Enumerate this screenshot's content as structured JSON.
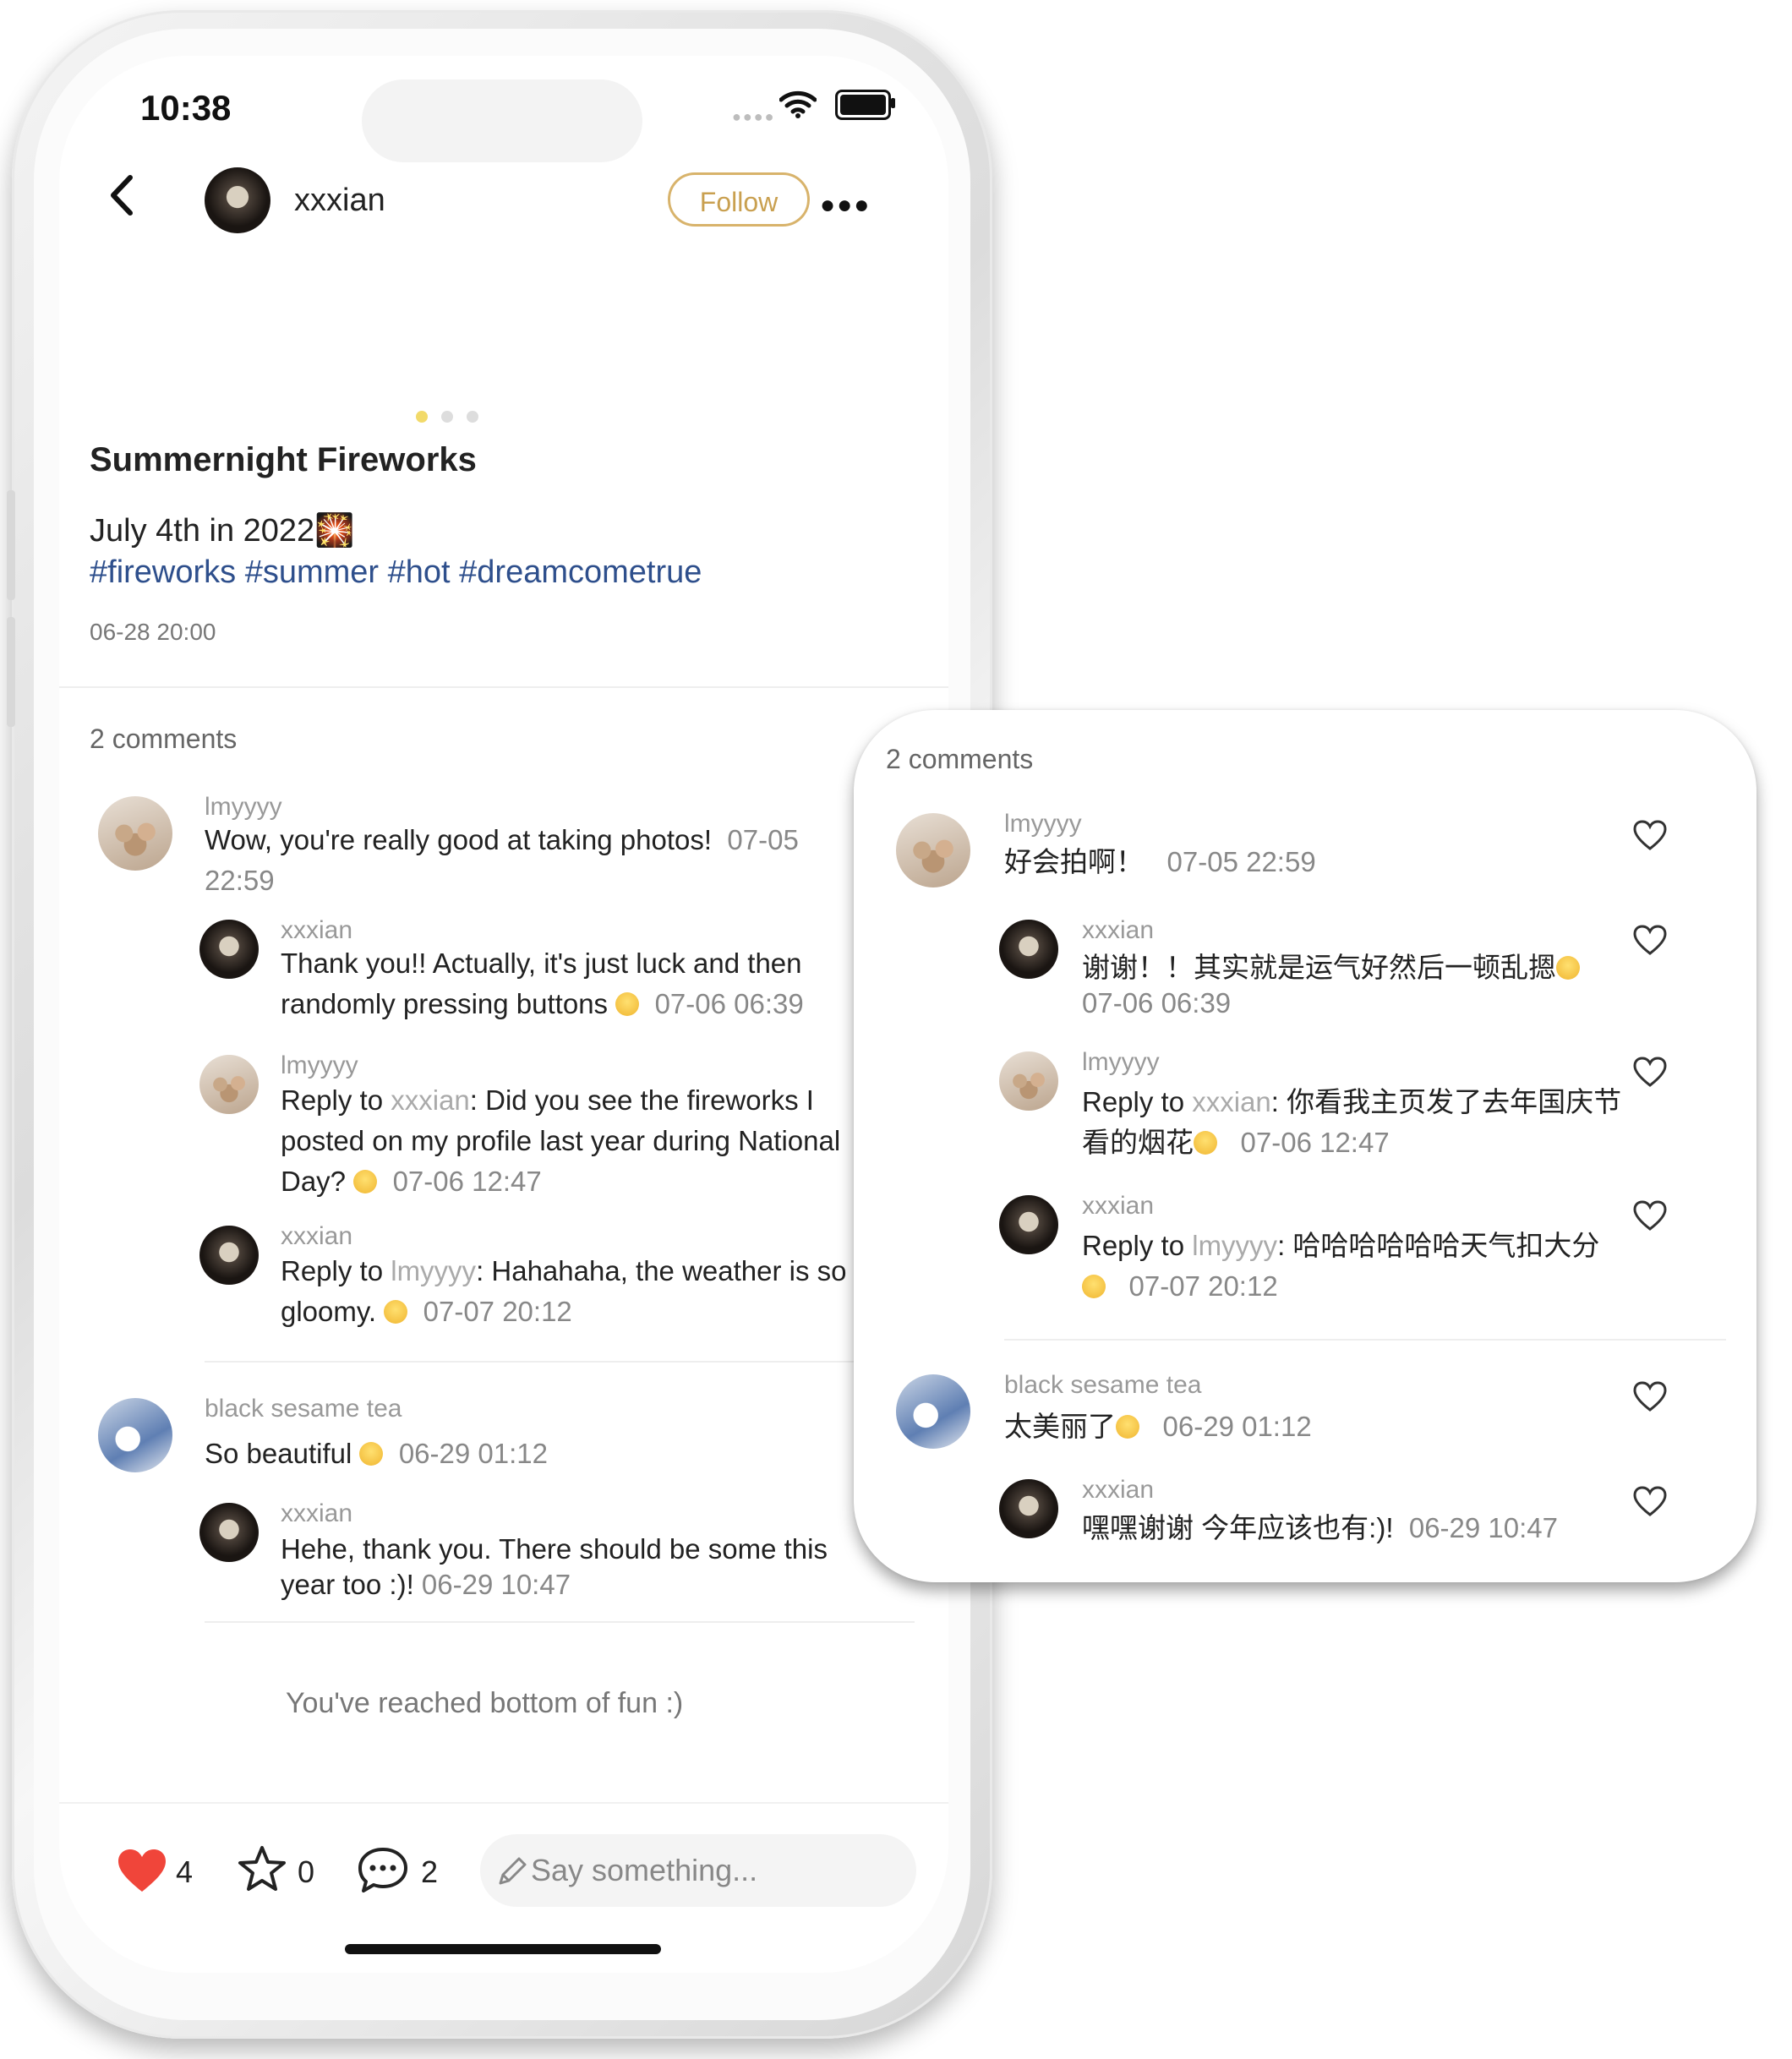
{
  "status": {
    "time": "10:38"
  },
  "header": {
    "username": "xxxian",
    "follow_label": "Follow"
  },
  "post": {
    "title": "Summernight Fireworks",
    "body": "July 4th in 2022🎇",
    "tags": "#fireworks #summer #hot #dreamcometrue",
    "date": "06-28 20:00",
    "carousel": {
      "pages": 3,
      "active": 1
    }
  },
  "comments_en": {
    "count_label": "2 comments",
    "threads": [
      {
        "name": "lmyyyy",
        "text": "Wow, you're really good at taking photos!",
        "time": "07-05 22:59",
        "replies": [
          {
            "name": "xxxian",
            "text": "Thank you!! Actually, it's just luck and then randomly pressing buttons",
            "time": "07-06 06:39"
          },
          {
            "name": "lmyyyy",
            "reply_prefix": "Reply to ",
            "reply_target": "xxxian",
            "text": ": Did you see the fireworks I posted on my profile last year during National Day?",
            "time": "07-06 12:47"
          },
          {
            "name": "xxxian",
            "reply_prefix": "Reply to ",
            "reply_target": "lmyyyy",
            "text": ": Hahahaha, the weather is so gloomy.",
            "time": "07-07 20:12"
          }
        ]
      },
      {
        "name": "black sesame tea",
        "text": "So beautiful",
        "time": "06-29 01:12",
        "replies": [
          {
            "name": "xxxian",
            "text": "Hehe, thank you. There should be some this year too :)!",
            "time": "06-29 10:47"
          }
        ]
      }
    ],
    "end_message": "You've reached bottom of fun :)"
  },
  "bottom_bar": {
    "likes": "4",
    "stars": "0",
    "comments": "2",
    "input_placeholder": "Say something..."
  },
  "comments_zh": {
    "count_label": "2 comments",
    "threads": [
      {
        "name": "lmyyyy",
        "text": "好会拍啊！",
        "time": "07-05 22:59",
        "replies": [
          {
            "name": "xxxian",
            "text": "谢谢！！其实就是运气好然后一顿乱摁",
            "time": "07-06 06:39"
          },
          {
            "name": "lmyyyy",
            "reply_prefix": "Reply to ",
            "reply_target": "xxxian",
            "text": ": 你看我主页发了去年国庆节看的烟花",
            "time": "07-06 12:47"
          },
          {
            "name": "xxxian",
            "reply_prefix": "Reply to ",
            "reply_target": "lmyyyy",
            "text": ": 哈哈哈哈哈哈天气扣大分",
            "time": "07-07 20:12"
          }
        ]
      },
      {
        "name": "black sesame tea",
        "text": "太美丽了",
        "time": "06-29 01:12",
        "replies": [
          {
            "name": "xxxian",
            "text": "嘿嘿谢谢 今年应该也有:)!",
            "time": "06-29 10:47"
          }
        ]
      }
    ]
  },
  "colors": {
    "follow_accent": "#d8b36b",
    "hashtag": "#2e4f8c",
    "like_red": "#f0453a",
    "carousel_active": "#f2da6a"
  }
}
